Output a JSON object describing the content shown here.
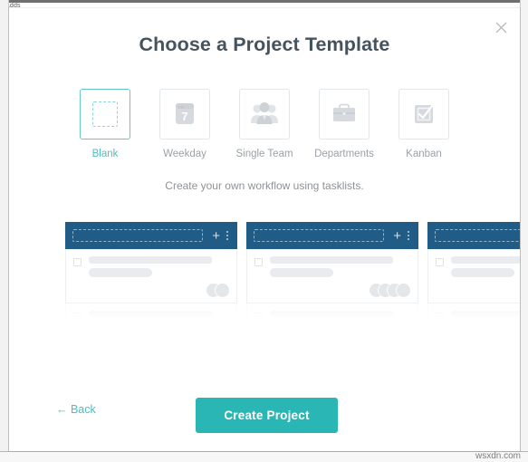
{
  "background": {
    "sliver_text": "Adds"
  },
  "modal": {
    "title": "Choose a Project Template",
    "close_label": "close-icon",
    "description": "Create your own workflow using tasklists.",
    "accent_color": "#2bb6b6",
    "title_color": "#45535e",
    "board_header_color": "#205c86"
  },
  "templates": [
    {
      "id": "blank",
      "label": "Blank",
      "icon": "dashed-square-icon",
      "selected": true
    },
    {
      "id": "weekday",
      "label": "Weekday",
      "icon": "calendar-icon",
      "selected": false,
      "calendar_day": "7",
      "calendar_month": "FRI"
    },
    {
      "id": "single-team",
      "label": "Single Team",
      "icon": "people-icon",
      "selected": false
    },
    {
      "id": "departments",
      "label": "Departments",
      "icon": "briefcase-icon",
      "selected": false
    },
    {
      "id": "kanban",
      "label": "Kanban",
      "icon": "checkbox-check-icon",
      "selected": false
    }
  ],
  "board_preview": {
    "columns": [
      {
        "id": "column-1",
        "avatar_count": 2
      },
      {
        "id": "column-2",
        "avatar_count": 4
      },
      {
        "id": "column-3",
        "avatar_count": 0
      }
    ]
  },
  "footer": {
    "back_label": "← Back",
    "create_label": "Create Project"
  },
  "watermark": "wsxdn.com"
}
